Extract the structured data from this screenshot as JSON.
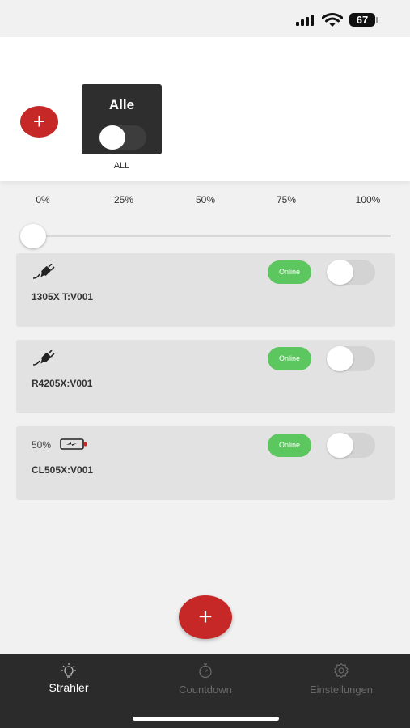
{
  "status_bar": {
    "battery_percent": "67",
    "signal_icon": "cellular-signal-icon",
    "wifi_icon": "wifi-icon"
  },
  "group": {
    "add_button_label": "+",
    "tile_name": "Alle",
    "tile_caption": "ALL",
    "tile_toggle_on": false
  },
  "brightness": {
    "ticks": [
      "0%",
      "25%",
      "50%",
      "75%",
      "100%"
    ],
    "value_percent": 0
  },
  "devices": [
    {
      "icon": "plug-icon",
      "battery_level": "",
      "name": "1305X T:V001",
      "status": "Online",
      "on": false
    },
    {
      "icon": "plug-icon",
      "battery_level": "",
      "name": "R4205X:V001",
      "status": "Online",
      "on": false
    },
    {
      "icon": "battery-charging-icon",
      "battery_level": "50%",
      "name": "CL505X:V001",
      "status": "Online",
      "on": false
    }
  ],
  "fab_label": "+",
  "nav": [
    {
      "label": "Strahler",
      "icon": "lightbulb-icon",
      "active": true
    },
    {
      "label": "Countdown",
      "icon": "stopwatch-icon",
      "active": false
    },
    {
      "label": "Einstellungen",
      "icon": "gear-icon",
      "active": false
    }
  ],
  "colors": {
    "accent": "#c62828",
    "online": "#5cc75e",
    "nav_bg": "#2b2b2b"
  }
}
